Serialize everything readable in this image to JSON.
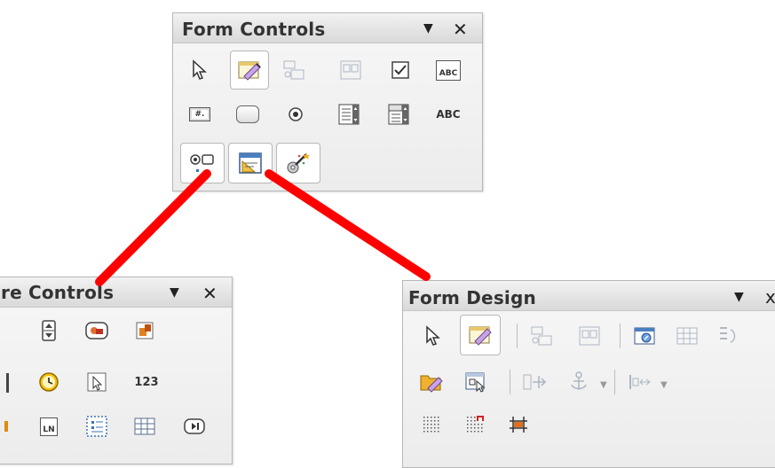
{
  "panels": {
    "form_controls": {
      "title": "Form Controls",
      "menu_icon": "▼",
      "close_icon": "✕"
    },
    "more_controls": {
      "title": "re Controls",
      "menu_icon": "▼",
      "close_icon": "✕"
    },
    "form_design": {
      "title": "Form Design",
      "menu_icon": "▼",
      "close_icon": "x"
    }
  },
  "labels": {
    "label_field": "ABC",
    "formatted_field": "#.",
    "text_abc": "ABC",
    "numeric_field": "123",
    "pattern_field": "LN"
  },
  "colors": {
    "connector": "#ff0000",
    "selected_border": "#b7b7b7",
    "titlebar": "#d9d9d9"
  }
}
